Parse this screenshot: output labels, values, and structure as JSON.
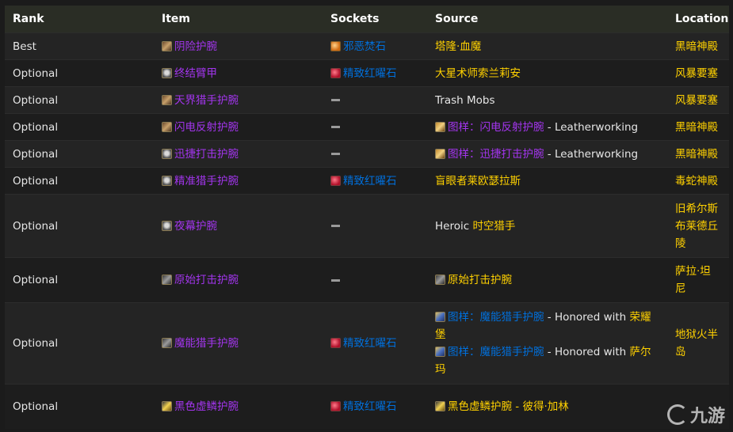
{
  "headers": {
    "rank": "Rank",
    "item": "Item",
    "sockets": "Sockets",
    "source": "Source",
    "location": "Location"
  },
  "rows": [
    {
      "rank": "Best",
      "item": "阴险护腕",
      "item_icon": "bracer-icon",
      "socket": "邪恶焚石",
      "socket_color": "blue",
      "socket_icon": "orange-gem-icon",
      "location": "黑暗神殿"
    },
    {
      "rank": "Optional",
      "item": "终结臂甲",
      "item_icon": "skull-bracer-icon",
      "socket": "精致红曜石",
      "socket_color": "blue",
      "socket_icon": "red-gem-icon",
      "location": "风暴要塞"
    },
    {
      "rank": "Optional",
      "item": "天界猎手护腕",
      "item_icon": "bracer-icon",
      "socket": "",
      "location": "风暴要塞"
    },
    {
      "rank": "Optional",
      "item": "闪电反射护腕",
      "item_icon": "bracer-icon",
      "socket": "",
      "location": "黑暗神殿"
    },
    {
      "rank": "Optional",
      "item": "迅捷打击护腕",
      "item_icon": "skull-bracer-icon",
      "socket": "",
      "location": "黑暗神殿"
    },
    {
      "rank": "Optional",
      "item": "精准猎手护腕",
      "item_icon": "skull-bracer-icon",
      "socket": "精致红曜石",
      "socket_color": "blue",
      "socket_icon": "red-gem-icon",
      "location": "毒蛇神殿"
    },
    {
      "rank": "Optional",
      "item": "夜幕护腕",
      "item_icon": "skull-bracer-icon",
      "socket": "",
      "location": "旧希尔斯布莱德丘陵"
    },
    {
      "rank": "Optional",
      "item": "原始打击护腕",
      "item_icon": "fist-bracer-icon",
      "socket": "",
      "location": "萨拉·坦尼"
    },
    {
      "rank": "Optional",
      "item": "魔能猎手护腕",
      "item_icon": "fist-bracer-icon",
      "socket": "精致红曜石",
      "socket_color": "blue",
      "socket_icon": "red-gem-icon",
      "location": "地狱火半岛"
    },
    {
      "rank": "Optional",
      "item": "黑色虚鳞护腕",
      "item_icon": "gold-bracer-icon",
      "socket": "精致红曜石",
      "socket_color": "blue",
      "socket_icon": "red-gem-icon",
      "location": ""
    }
  ],
  "sources": {
    "r0": {
      "boss": "塔隆·血魔"
    },
    "r1": {
      "boss": "大星术师索兰莉安"
    },
    "r2": {
      "text": "Trash Mobs"
    },
    "r3": {
      "link": "图样：闪电反射护腕",
      "suffix": " - Leatherworking"
    },
    "r4": {
      "link": "图样：迅捷打击护腕",
      "suffix": " - Leatherworking"
    },
    "r5": {
      "boss": "盲眼者莱欧瑟拉斯"
    },
    "r6": {
      "prefix": "Heroic ",
      "boss": "时空猎手"
    },
    "r7": {
      "text": "原始打击护腕"
    },
    "r8": {
      "l1_link": "图样：魔能猎手护腕",
      "l1_mid": " - Honored with ",
      "l1_faction": "荣耀堡",
      "l2_link": "图样：魔能猎手护腕",
      "l2_mid": " - Honored with ",
      "l2_faction": "萨尔玛"
    },
    "r9": {
      "text": "黑色虚鳞护腕 - 彼得·加林"
    }
  },
  "watermark": "九游",
  "colors": {
    "epic": "#a335ee",
    "rare": "#0070dd",
    "npc": "#ffd100",
    "header_bg": "#2a2d25"
  }
}
